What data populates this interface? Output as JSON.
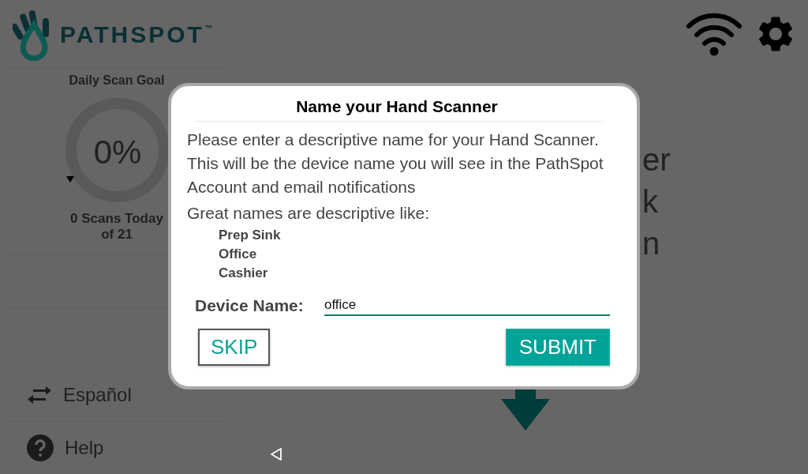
{
  "header": {
    "logo_text": "PATHSPOT",
    "trademark": "™"
  },
  "sidebar": {
    "goal_title": "Daily Scan Goal",
    "goal_percent": "0%",
    "scans_today": "0 Scans Today",
    "scans_goal": "of 21",
    "items": [
      {
        "kind": "language",
        "label": "Español"
      },
      {
        "kind": "help",
        "label": "Help"
      }
    ]
  },
  "main": {
    "fragments": [
      "er",
      "k",
      "n"
    ]
  },
  "dialog": {
    "title": "Name your Hand Scanner",
    "description": "Please enter a descriptive name for your Hand Scanner. This will be the device name you will see in the PathSpot Account and email notifications",
    "examples_intro": "Great names are descriptive like:",
    "examples": [
      "Prep Sink",
      "Office",
      "Cashier"
    ],
    "field_label": "Device Name:",
    "field_value": "office",
    "buttons": [
      {
        "kind": "secondary",
        "label": "SKIP"
      },
      {
        "kind": "primary",
        "label": "SUBMIT"
      }
    ]
  }
}
